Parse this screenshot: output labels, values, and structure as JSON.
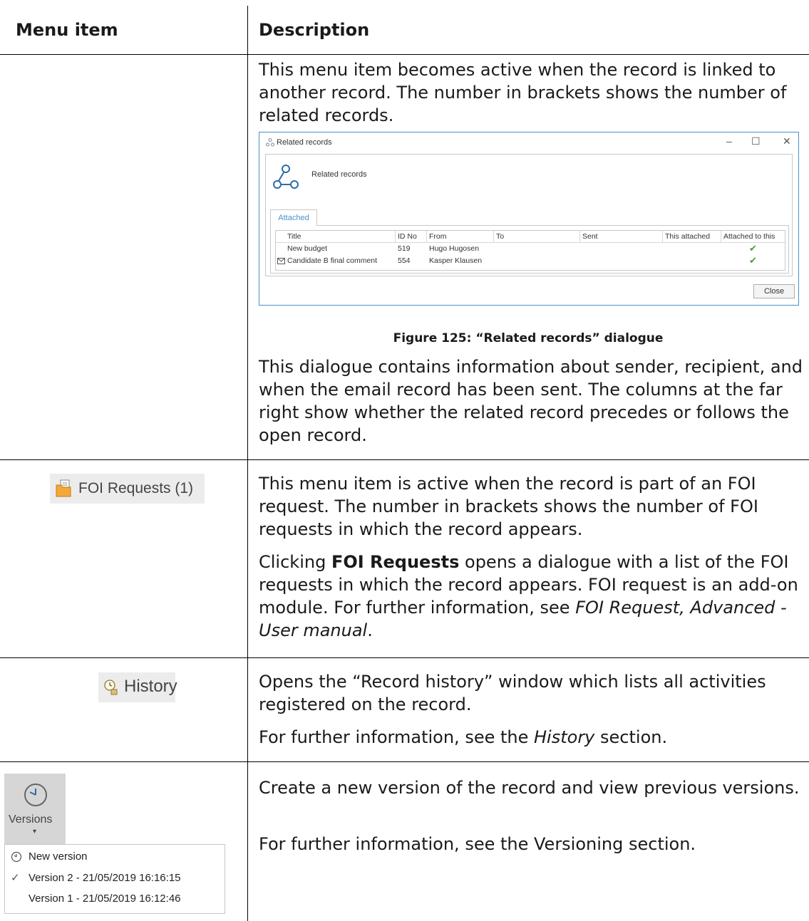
{
  "table": {
    "col_menu_header": "Menu item",
    "col_desc_header": "Description"
  },
  "related": {
    "para1": "This menu item becomes active when the record is linked to another record. The number in brackets shows the number of related records.",
    "caption": "Figure 125: “Related records” dialogue",
    "para2": "This dialogue contains information about sender, recipient, and when the email record has been sent. The columns at the far right show whether the related record precedes or follows the open record."
  },
  "dialog": {
    "window_title": "Related records",
    "header_label": "Related records",
    "tab": "Attached",
    "columns": [
      "Title",
      "ID No",
      "From",
      "To",
      "Sent",
      "This attached",
      "Attached to this"
    ],
    "rows": [
      {
        "title": "New budget",
        "id": "519",
        "from": "Hugo Hugosen",
        "to": "",
        "sent": "",
        "this_attached": "",
        "attached_to_this": "✔",
        "icon": ""
      },
      {
        "title": "Candidate B final comment",
        "id": "554",
        "from": "Kasper Klausen",
        "to": "",
        "sent": "",
        "this_attached": "",
        "attached_to_this": "✔",
        "icon": "envelope-icon"
      }
    ],
    "close_label": "Close",
    "minimize_glyph": "–",
    "maximize_glyph": "☐",
    "close_glyph": "✕"
  },
  "foi": {
    "button_label": "FOI Requests (1)",
    "para1": "This menu item is active when the record is part of an FOI request. The number in brackets shows the number of FOI requests in which the record appears.",
    "para2_prefix": "Clicking ",
    "para2_bold": "FOI Requests",
    "para2_mid": " opens a dialogue with a list of the FOI requests in which the record appears. FOI request is an add-on module. For further information, see ",
    "para2_italic": "FOI Request, Advanced - User manual",
    "para2_suffix": "."
  },
  "history": {
    "button_label": "History",
    "para1": "Opens the “Record history” window which lists all activities registered on the record.",
    "para2_prefix": "For further information, see the ",
    "para2_italic": "History",
    "para2_suffix": " section."
  },
  "versions": {
    "button_label": "Versions",
    "menu": [
      {
        "label": "New version",
        "icon": "clock-icon"
      },
      {
        "label": "Version 2 - 21/05/2019 16:16:15",
        "icon": "check-icon"
      },
      {
        "label": "Version 1 - 21/05/2019 16:12:46",
        "icon": ""
      }
    ],
    "para1": "Create a new version of the record and view previous versions.",
    "para2": "For further information, see the Versioning section."
  }
}
